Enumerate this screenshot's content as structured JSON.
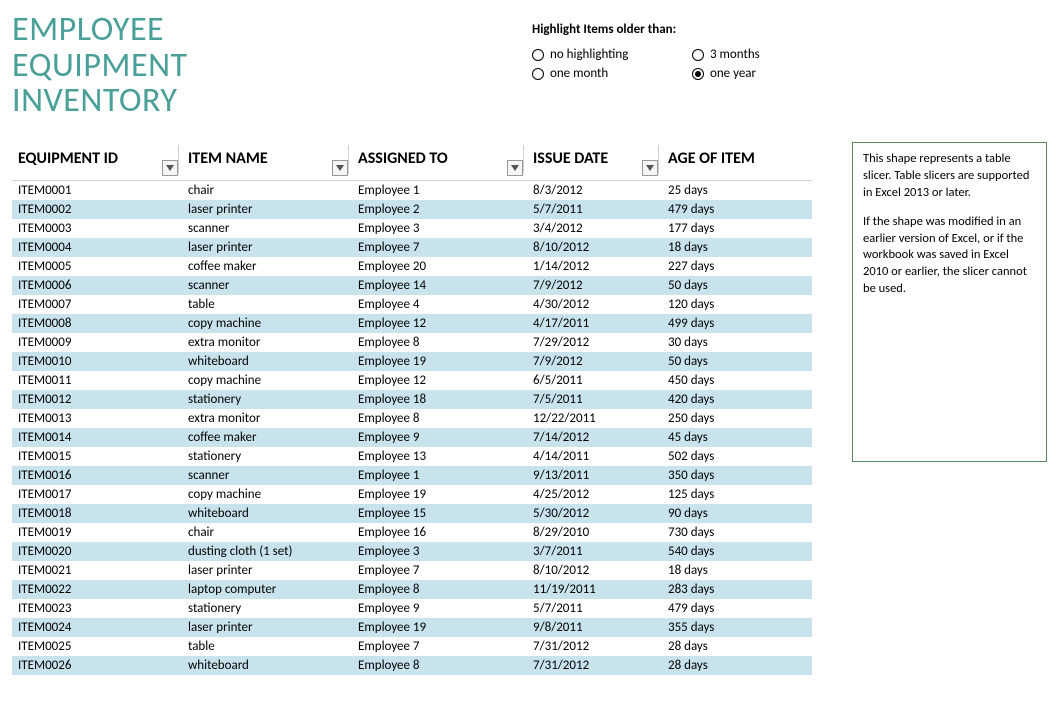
{
  "title_line1": "EMPLOYEE",
  "title_line2": "EQUIPMENT",
  "title_line3": "INVENTORY",
  "highlight_label": "Highlight Items older than:",
  "radios": {
    "none": "no highlighting",
    "one_month": "one month",
    "three_months": "3 months",
    "one_year": "one year"
  },
  "selected_radio": "one_year",
  "headers": {
    "id": "EQUIPMENT ID",
    "name": "ITEM NAME",
    "assigned": "ASSIGNED TO",
    "date": "ISSUE DATE",
    "age": "AGE OF ITEM"
  },
  "rows": [
    {
      "id": "ITEM0001",
      "name": "chair",
      "assigned": "Employee 1",
      "date": "8/3/2012",
      "age": "25 days"
    },
    {
      "id": "ITEM0002",
      "name": "laser printer",
      "assigned": "Employee 2",
      "date": "5/7/2011",
      "age": "479 days"
    },
    {
      "id": "ITEM0003",
      "name": "scanner",
      "assigned": "Employee 3",
      "date": "3/4/2012",
      "age": "177 days"
    },
    {
      "id": "ITEM0004",
      "name": "laser printer",
      "assigned": "Employee 7",
      "date": "8/10/2012",
      "age": "18 days"
    },
    {
      "id": "ITEM0005",
      "name": "coffee maker",
      "assigned": "Employee 20",
      "date": "1/14/2012",
      "age": "227 days"
    },
    {
      "id": "ITEM0006",
      "name": "scanner",
      "assigned": "Employee 14",
      "date": "7/9/2012",
      "age": "50 days"
    },
    {
      "id": "ITEM0007",
      "name": "table",
      "assigned": "Employee 4",
      "date": "4/30/2012",
      "age": "120 days"
    },
    {
      "id": "ITEM0008",
      "name": "copy machine",
      "assigned": "Employee 12",
      "date": "4/17/2011",
      "age": "499 days"
    },
    {
      "id": "ITEM0009",
      "name": "extra monitor",
      "assigned": "Employee 8",
      "date": "7/29/2012",
      "age": "30 days"
    },
    {
      "id": "ITEM0010",
      "name": "whiteboard",
      "assigned": "Employee 19",
      "date": "7/9/2012",
      "age": "50 days"
    },
    {
      "id": "ITEM0011",
      "name": "copy machine",
      "assigned": "Employee 12",
      "date": "6/5/2011",
      "age": "450 days"
    },
    {
      "id": "ITEM0012",
      "name": "stationery",
      "assigned": "Employee 18",
      "date": "7/5/2011",
      "age": "420 days"
    },
    {
      "id": "ITEM0013",
      "name": "extra monitor",
      "assigned": "Employee 8",
      "date": "12/22/2011",
      "age": "250 days"
    },
    {
      "id": "ITEM0014",
      "name": "coffee maker",
      "assigned": "Employee 9",
      "date": "7/14/2012",
      "age": "45 days"
    },
    {
      "id": "ITEM0015",
      "name": "stationery",
      "assigned": "Employee 13",
      "date": "4/14/2011",
      "age": "502 days"
    },
    {
      "id": "ITEM0016",
      "name": "scanner",
      "assigned": "Employee 1",
      "date": "9/13/2011",
      "age": "350 days"
    },
    {
      "id": "ITEM0017",
      "name": "copy machine",
      "assigned": "Employee 19",
      "date": "4/25/2012",
      "age": "125 days"
    },
    {
      "id": "ITEM0018",
      "name": "whiteboard",
      "assigned": "Employee 15",
      "date": "5/30/2012",
      "age": "90 days"
    },
    {
      "id": "ITEM0019",
      "name": "chair",
      "assigned": "Employee 16",
      "date": "8/29/2010",
      "age": "730 days"
    },
    {
      "id": "ITEM0020",
      "name": "dusting cloth (1 set)",
      "assigned": "Employee 3",
      "date": "3/7/2011",
      "age": "540 days"
    },
    {
      "id": "ITEM0021",
      "name": "laser printer",
      "assigned": "Employee 7",
      "date": "8/10/2012",
      "age": "18 days"
    },
    {
      "id": "ITEM0022",
      "name": "laptop computer",
      "assigned": "Employee 8",
      "date": "11/19/2011",
      "age": "283 days"
    },
    {
      "id": "ITEM0023",
      "name": "stationery",
      "assigned": "Employee 9",
      "date": "5/7/2011",
      "age": "479 days"
    },
    {
      "id": "ITEM0024",
      "name": "laser printer",
      "assigned": "Employee 19",
      "date": "9/8/2011",
      "age": "355 days"
    },
    {
      "id": "ITEM0025",
      "name": "table",
      "assigned": "Employee 7",
      "date": "7/31/2012",
      "age": "28 days"
    },
    {
      "id": "ITEM0026",
      "name": "whiteboard",
      "assigned": "Employee 8",
      "date": "7/31/2012",
      "age": "28 days"
    }
  ],
  "slicer": {
    "p1": "This shape represents a table slicer. Table slicers are supported in Excel 2013 or later.",
    "p2": "If the shape was modified in an earlier version of Excel, or if the workbook was saved in Excel 2010 or earlier, the slicer cannot be used."
  }
}
